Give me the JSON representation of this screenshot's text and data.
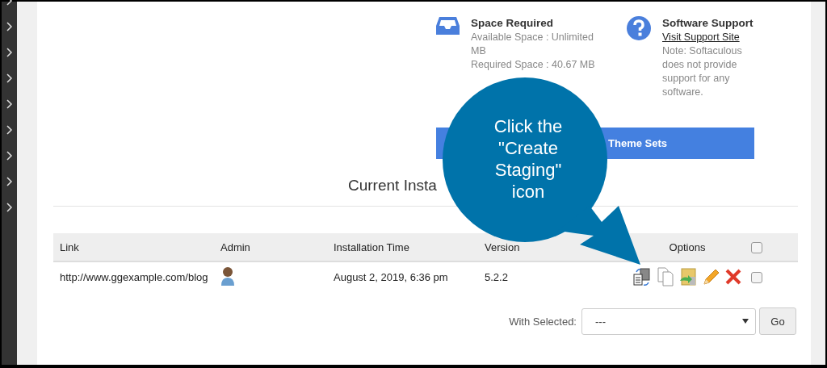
{
  "info": [
    {
      "kind": "space",
      "title": "Space Required",
      "lines": [
        "Available Space : Unlimited MB",
        "Required Space : 40.67 MB"
      ]
    },
    {
      "kind": "support",
      "title": "Software Support",
      "link": "Visit Support Site",
      "lines": [
        "Note: Softaculous does not provide support for any software."
      ]
    }
  ],
  "theme_button": {
    "label": "Theme Sets"
  },
  "heading": "Current Insta",
  "table": {
    "columns": [
      "Link",
      "Admin",
      "Installation Time",
      "Version",
      "Options"
    ],
    "select_all": {
      "checked": false
    },
    "rows": [
      {
        "link": "http://www.ggexample.com/blog",
        "installation_time": "August 2, 2019, 6:36 pm",
        "version": "5.2.2",
        "checked": false
      }
    ]
  },
  "bulk": {
    "label": "With Selected:",
    "value": "---",
    "button": "Go"
  },
  "callout": {
    "text": "Click the \"Create Staging\" icon"
  }
}
